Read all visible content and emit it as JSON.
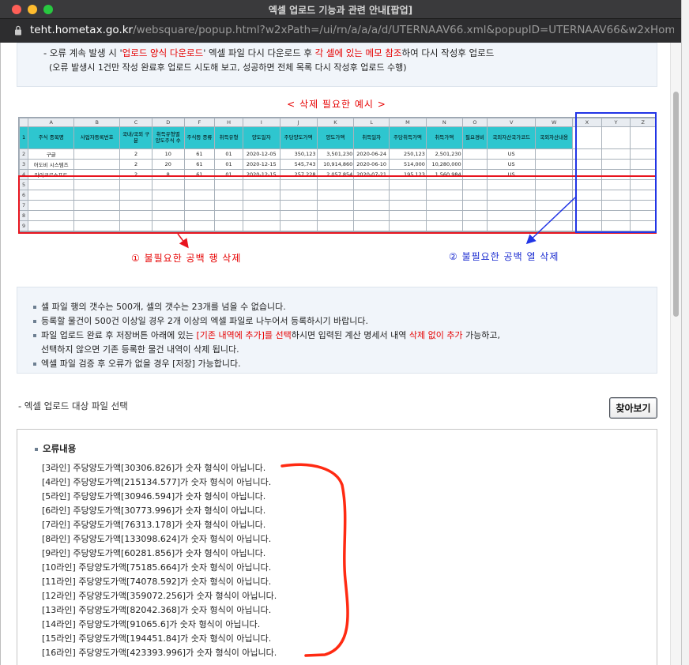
{
  "window": {
    "title": "엑셀 업로드 기능과 관련 안내[팝업]",
    "url_host": "teht.hometax.go.kr",
    "url_rest": "/websquare/popup.html?w2xPath=/ui/rn/a/a/a/d/UTERNAAV66.xml&popupID=UTERNAAV66&w2xHom..."
  },
  "top_box": {
    "line1_prefix": "- 오류 계속 발생 시 '",
    "line1_red1": "업로드 양식 다운로드",
    "line1_mid": "' 엑셀 파일 다시 다운로드 후 ",
    "line1_red2": "각 셀에 있는 메모 참조",
    "line1_suffix": "하여 다시 작성후 업로드",
    "line2": "(오류 발생시 1건만 작성 완료후 업로드 시도해 보고, 성공하면 전체 목록 다시 작성후 업로드 수행)"
  },
  "sample": {
    "title": "< 삭제 필요한 예시 >",
    "column_letters": [
      "A",
      "B",
      "C",
      "D",
      "F",
      "H",
      "I",
      "J",
      "K",
      "L",
      "M",
      "N",
      "O",
      "V",
      "W",
      "X",
      "Y",
      "Z"
    ],
    "headers": [
      "주식 종목명",
      "사업자등록번호",
      "국내/국외 구분",
      "취득유형별 양도주식 수",
      "주식등 종류",
      "취득유형",
      "양도일자",
      "주당양도가액",
      "양도가액",
      "취득일자",
      "주당취득가액",
      "취득가액",
      "필요경비",
      "국외자산국가코드",
      "국외자산내용",
      "",
      "",
      ""
    ],
    "rows": [
      [
        "구글",
        "",
        "2",
        "10",
        "61",
        "01",
        "2020-12-05",
        "350,123",
        "3,501,230",
        "2020-06-24",
        "250,123",
        "2,501,230",
        "",
        "US",
        "",
        "",
        "",
        ""
      ],
      [
        "어도비 시스템즈",
        "",
        "2",
        "20",
        "61",
        "01",
        "2020-12-15",
        "545,743",
        "10,914,860",
        "2020-06-10",
        "514,000",
        "10,280,000",
        "",
        "US",
        "",
        "",
        "",
        ""
      ],
      [
        "마이크로소프트",
        "",
        "2",
        "8",
        "61",
        "01",
        "2020-12-15",
        "257,228",
        "2,057,854",
        "2020-07-21",
        "195,123",
        "1,560,984",
        "",
        "US",
        "",
        "",
        "",
        ""
      ]
    ],
    "row_numbers": [
      "1",
      "2",
      "3",
      "4",
      "5",
      "6",
      "7",
      "8",
      "9"
    ],
    "annotation_rows": "① 불필요한 공백 행 삭제",
    "annotation_cols": "② 불필요한 공백 열 삭제"
  },
  "notes": {
    "items": [
      {
        "text": "셀 파일 행의 갯수는 500개, 셀의 갯수는 23개를 넘을 수 없습니다."
      },
      {
        "text": "등록할 물건이 500건 이상일 경우 2개 이상의 엑셀 파일로 나누어서 등록하시기 바랍니다."
      },
      {
        "prefix": "파일 업로드 완료 후 저장버튼 아래에 있는 ",
        "red1": "[기존 내역에 추가]를 선택",
        "mid": "하시면 입력된 계산 명세서 내역 ",
        "red2": "삭제 없이 추가",
        "suffix": " 가능하고,"
      },
      {
        "text": "선택하지 않으면 기존 등록한 물건 내역이 삭제 됩니다.",
        "indent": true
      },
      {
        "text": "엑셀 파일 검증 후 오류가 없을 경우 [저장] 가능합니다."
      }
    ]
  },
  "file_select": {
    "label": "- 엑셀 업로드 대상 파일 선택",
    "button": "찾아보기"
  },
  "errors": {
    "title": "오류내용",
    "items": [
      "[3라인] 주당양도가액[30306.826]가 숫자 형식이 아닙니다.",
      "[4라인] 주당양도가액[215134.577]가 숫자 형식이 아닙니다.",
      "[5라인] 주당양도가액[30946.594]가 숫자 형식이 아닙니다.",
      "[6라인] 주당양도가액[30773.996]가 숫자 형식이 아닙니다.",
      "[7라인] 주당양도가액[76313.178]가 숫자 형식이 아닙니다.",
      "[8라인] 주당양도가액[133098.624]가 숫자 형식이 아닙니다.",
      "[9라인] 주당양도가액[60281.856]가 숫자 형식이 아닙니다.",
      "[10라인] 주당양도가액[75185.664]가 숫자 형식이 아닙니다.",
      "[11라인] 주당양도가액[74078.592]가 숫자 형식이 아닙니다.",
      "[12라인] 주당양도가액[359072.256]가 숫자 형식이 아닙니다.",
      "[13라인] 주당양도가액[82042.368]가 숫자 형식이 아닙니다.",
      "[14라인] 주당양도가액[91065.6]가 숫자 형식이 아닙니다.",
      "[15라인] 주당양도가액[194451.84]가 숫자 형식이 아닙니다.",
      "[16라인] 주당양도가액[423393.996]가 숫자 형식이 아닙니다."
    ]
  },
  "colors": {
    "header_fill": "#2ec6cf",
    "annotation_red": "#e8141e",
    "annotation_blue": "#2135e6"
  }
}
